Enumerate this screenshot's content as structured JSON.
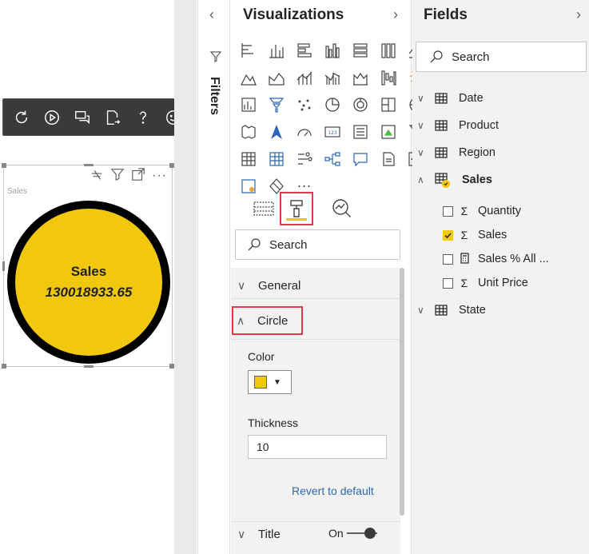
{
  "visual": {
    "title": "Sales",
    "circle_label": "Sales",
    "circle_value": "130018933.65",
    "circle_color": "#f2c80f"
  },
  "toolbar": {
    "icons": [
      "refresh-icon",
      "play-icon",
      "chat-icon",
      "export-icon",
      "help-icon",
      "smiley-icon"
    ]
  },
  "filters": {
    "label": "Filters"
  },
  "visualizations": {
    "title": "Visualizations",
    "search_placeholder": "Search",
    "format_sections": {
      "general": "General",
      "circle": "Circle",
      "title": "Title"
    },
    "circle": {
      "color_label": "Color",
      "color_value": "#f2c80f",
      "thickness_label": "Thickness",
      "thickness_value": "10",
      "revert_label": "Revert to default"
    },
    "title_toggle": "On",
    "more_label": "···"
  },
  "fields": {
    "title": "Fields",
    "search_placeholder": "Search",
    "tables": [
      {
        "name": "Date"
      },
      {
        "name": "Product"
      },
      {
        "name": "Region"
      },
      {
        "name": "Sales"
      },
      {
        "name": "State"
      }
    ],
    "sales_fields": [
      {
        "name": "Quantity",
        "checked": false,
        "icon": "sigma"
      },
      {
        "name": "Sales",
        "checked": true,
        "icon": "sigma"
      },
      {
        "name": "Sales % All ...",
        "checked": false,
        "icon": "calculator"
      },
      {
        "name": "Unit Price",
        "checked": false,
        "icon": "sigma"
      }
    ]
  }
}
